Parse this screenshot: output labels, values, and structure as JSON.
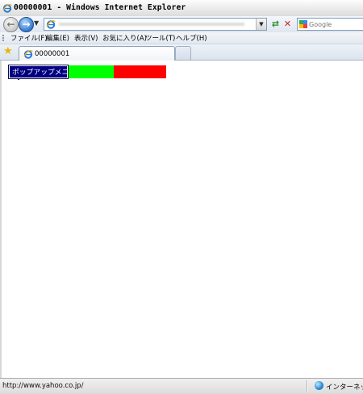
{
  "window": {
    "title": "00000001 - Windows Internet Explorer"
  },
  "toolbar": {
    "back_icon": "back-arrow-icon",
    "forward_icon": "forward-arrow-icon",
    "search_placeholder": "Google"
  },
  "menu": {
    "items": [
      {
        "label": "ファイル(F)"
      },
      {
        "label": "編集(E)"
      },
      {
        "label": "表示(V)"
      },
      {
        "label": "お気に入り(A)"
      },
      {
        "label": "ツール(T)"
      },
      {
        "label": "ヘルプ(H)"
      }
    ]
  },
  "tabs": {
    "active_label": "00000001"
  },
  "content": {
    "popup_menu_label": "ポップアップメニュ",
    "colors": {
      "popup_bg": "#000080",
      "green_block": "#00ff00",
      "red_block": "#ff0000"
    }
  },
  "status": {
    "url": "http://www.yahoo.co.jp/",
    "zone": "インターネット"
  }
}
